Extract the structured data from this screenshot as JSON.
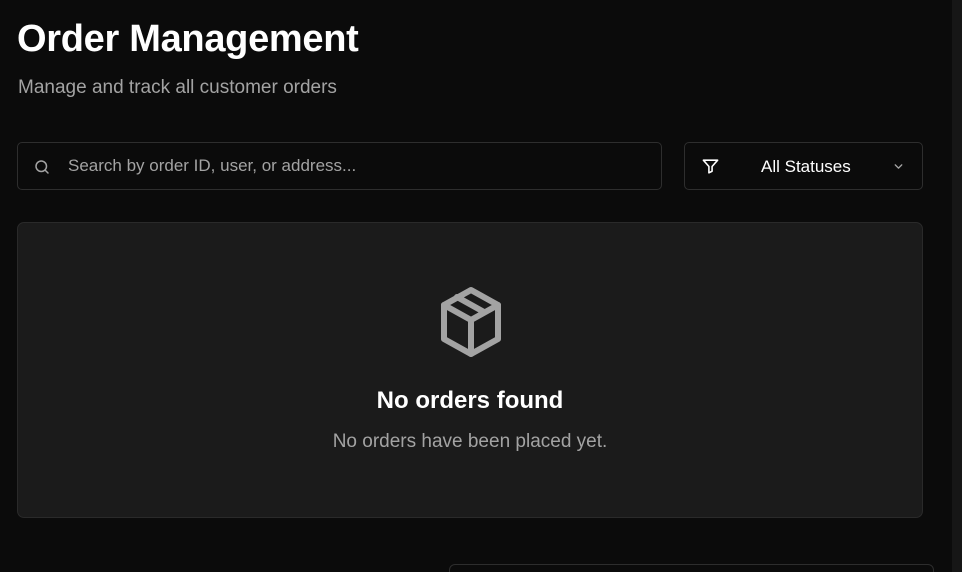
{
  "header": {
    "title": "Order Management",
    "subtitle": "Manage and track all customer orders"
  },
  "search": {
    "placeholder": "Search by order ID, user, or address...",
    "value": "",
    "icon": "search-icon"
  },
  "filter": {
    "selected_label": "All Statuses",
    "icon": "filter-icon",
    "dropdown_icon": "chevron-down-icon"
  },
  "empty_state": {
    "icon": "package-icon",
    "title": "No orders found",
    "message": "No orders have been placed yet."
  },
  "colors": {
    "background": "#0b0b0b",
    "card_background": "#1b1b1b",
    "border": "#2e2e2e",
    "primary_text": "#ffffff",
    "secondary_text": "#a3a3a3",
    "icon": "#a3a3a3"
  }
}
